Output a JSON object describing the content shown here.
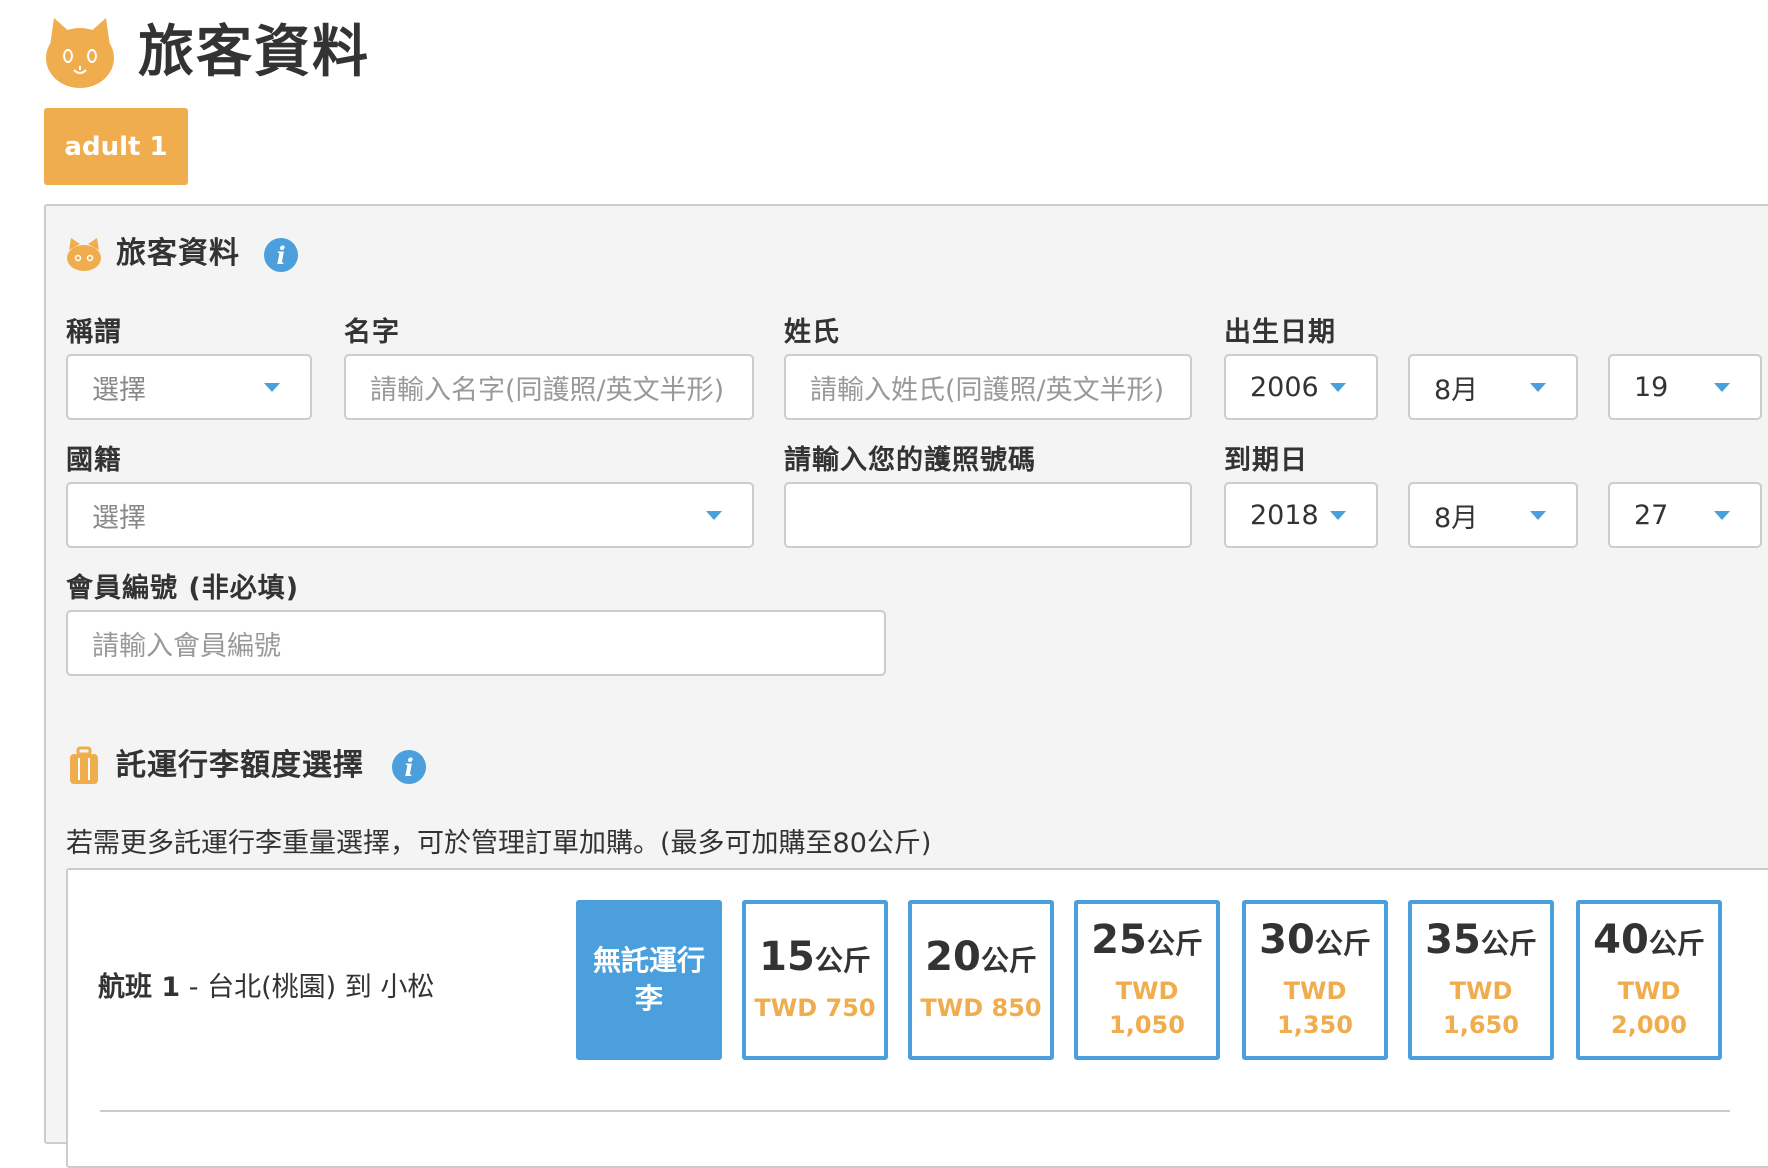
{
  "header": {
    "title": "旅客資料",
    "tab_label": "adult 1"
  },
  "passenger": {
    "section_title": "旅客資料",
    "title_label": "稱謂",
    "title_value": "選擇",
    "first_name_label": "名字",
    "first_name_placeholder": "請輸入名字(同護照/英文半形)",
    "last_name_label": "姓氏",
    "last_name_placeholder": "請輸入姓氏(同護照/英文半形)",
    "dob_label": "出生日期",
    "dob_year": "2006",
    "dob_month": "8月",
    "dob_day": "19",
    "nationality_label": "國籍",
    "nationality_value": "選擇",
    "passport_label": "請輸入您的護照號碼",
    "passport_value": "",
    "expiry_label": "到期日",
    "expiry_year": "2018",
    "expiry_month": "8月",
    "expiry_day": "27",
    "member_label": "會員編號 (非必填)",
    "member_placeholder": "請輸入會員編號"
  },
  "baggage": {
    "section_title": "託運行李額度選擇",
    "note": "若需更多託運行李重量選擇，可於管理訂單加購。(最多可加購至80公斤)",
    "flight_prefix": "航班 1",
    "flight_route": " - 台北(桃園) 到 小松",
    "none_label": "無託運行李",
    "unit": "公斤",
    "options": [
      {
        "kg": "15",
        "price": "TWD 750"
      },
      {
        "kg": "20",
        "price": "TWD 850"
      },
      {
        "kg": "25",
        "price_line1": "TWD",
        "price_line2": "1,050"
      },
      {
        "kg": "30",
        "price_line1": "TWD",
        "price_line2": "1,350"
      },
      {
        "kg": "35",
        "price_line1": "TWD",
        "price_line2": "1,650"
      },
      {
        "kg": "40",
        "price_line1": "TWD",
        "price_line2": "2,000"
      }
    ]
  },
  "colors": {
    "accent_orange": "#f0ad4e",
    "accent_blue": "#4a9fdc"
  },
  "icons": {
    "logo": "cat-face-icon",
    "info": "info-icon",
    "luggage": "luggage-icon"
  }
}
